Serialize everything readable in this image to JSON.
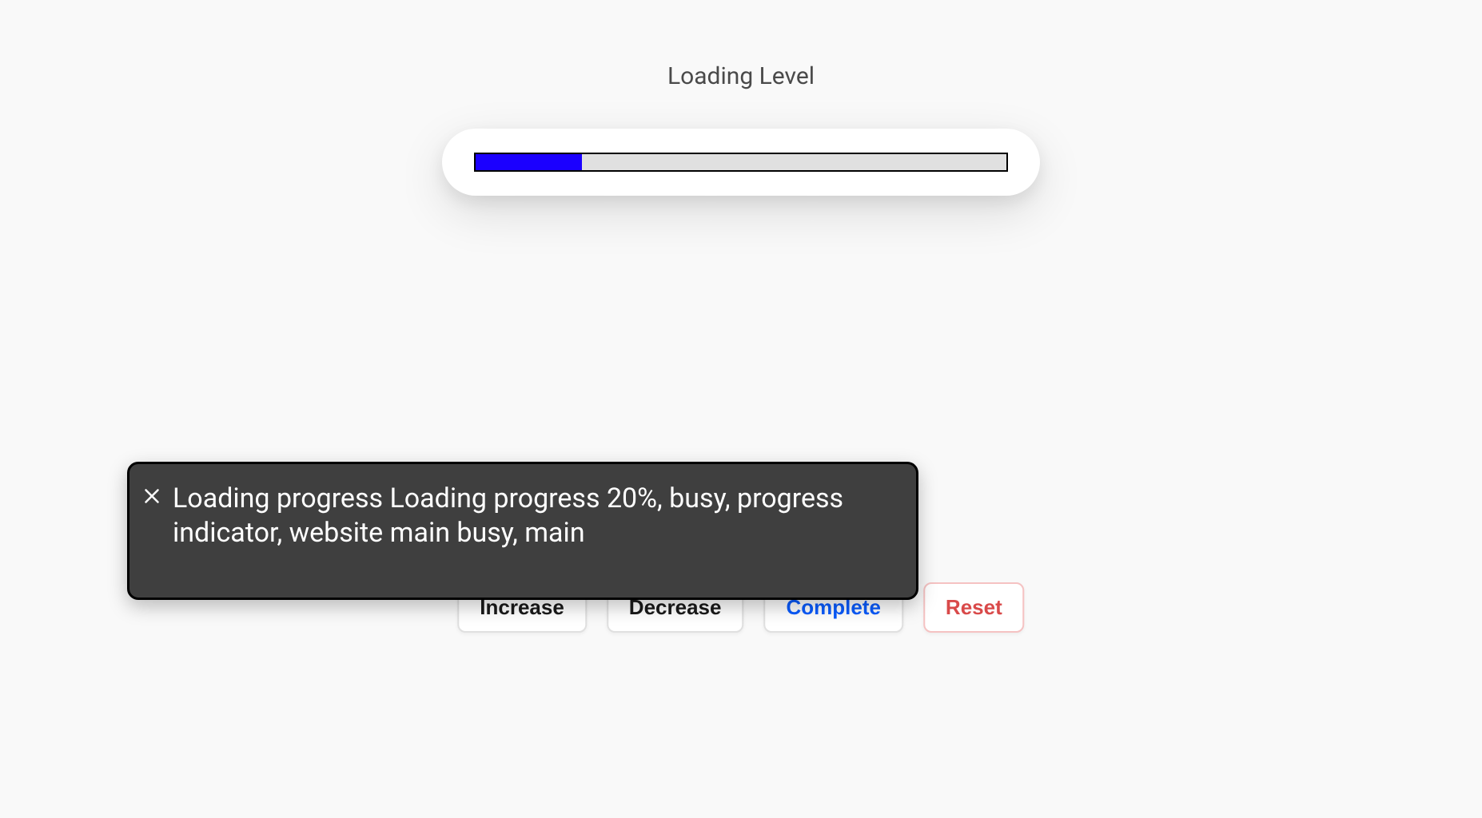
{
  "heading": "Loading Level",
  "progress": {
    "percent": 20,
    "fill_color": "#1b00ff",
    "track_color": "#e0e0e0"
  },
  "buttons": {
    "increase": "Increase",
    "decrease": "Decrease",
    "complete": "Complete",
    "reset": "Reset"
  },
  "tooltip": {
    "text": "Loading progress Loading progress 20%, busy, progress indicator, website main busy, main"
  }
}
